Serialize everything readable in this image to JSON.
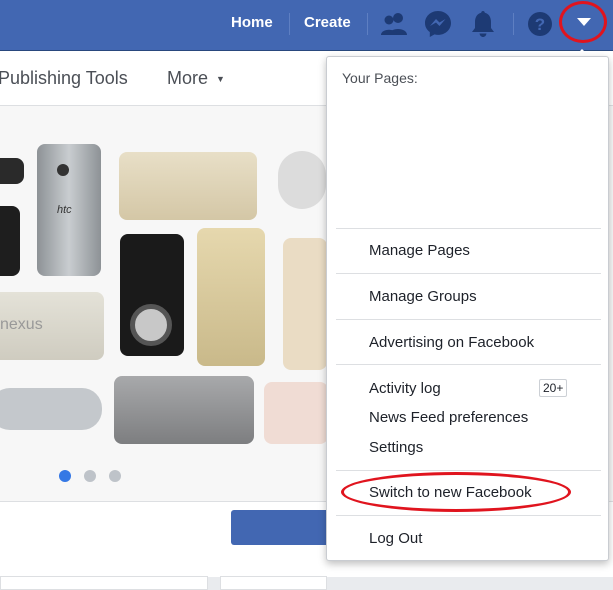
{
  "topbar": {
    "home_label": "Home",
    "create_label": "Create",
    "icons": [
      "friends-icon",
      "messenger-icon",
      "notifications-icon",
      "help-icon",
      "account-menu-icon"
    ],
    "bar_color": "#4267b2"
  },
  "subbar": {
    "publishing_tools_label": "Publishing Tools",
    "more_label": "More",
    "more_caret": "▼"
  },
  "carousel": {
    "active_dot_color": "#3578e5",
    "inactive_dot_color": "#bec3c9"
  },
  "menu": {
    "header": "Your Pages:",
    "items": {
      "manage_pages": "Manage Pages",
      "manage_groups": "Manage Groups",
      "advertising": "Advertising on Facebook",
      "activity_log": "Activity log",
      "activity_badge": "20+",
      "news_feed_prefs": "News Feed preferences",
      "settings": "Settings",
      "switch_new": "Switch to new Facebook",
      "log_out": "Log Out"
    },
    "highlight_color": "#e0141e"
  }
}
